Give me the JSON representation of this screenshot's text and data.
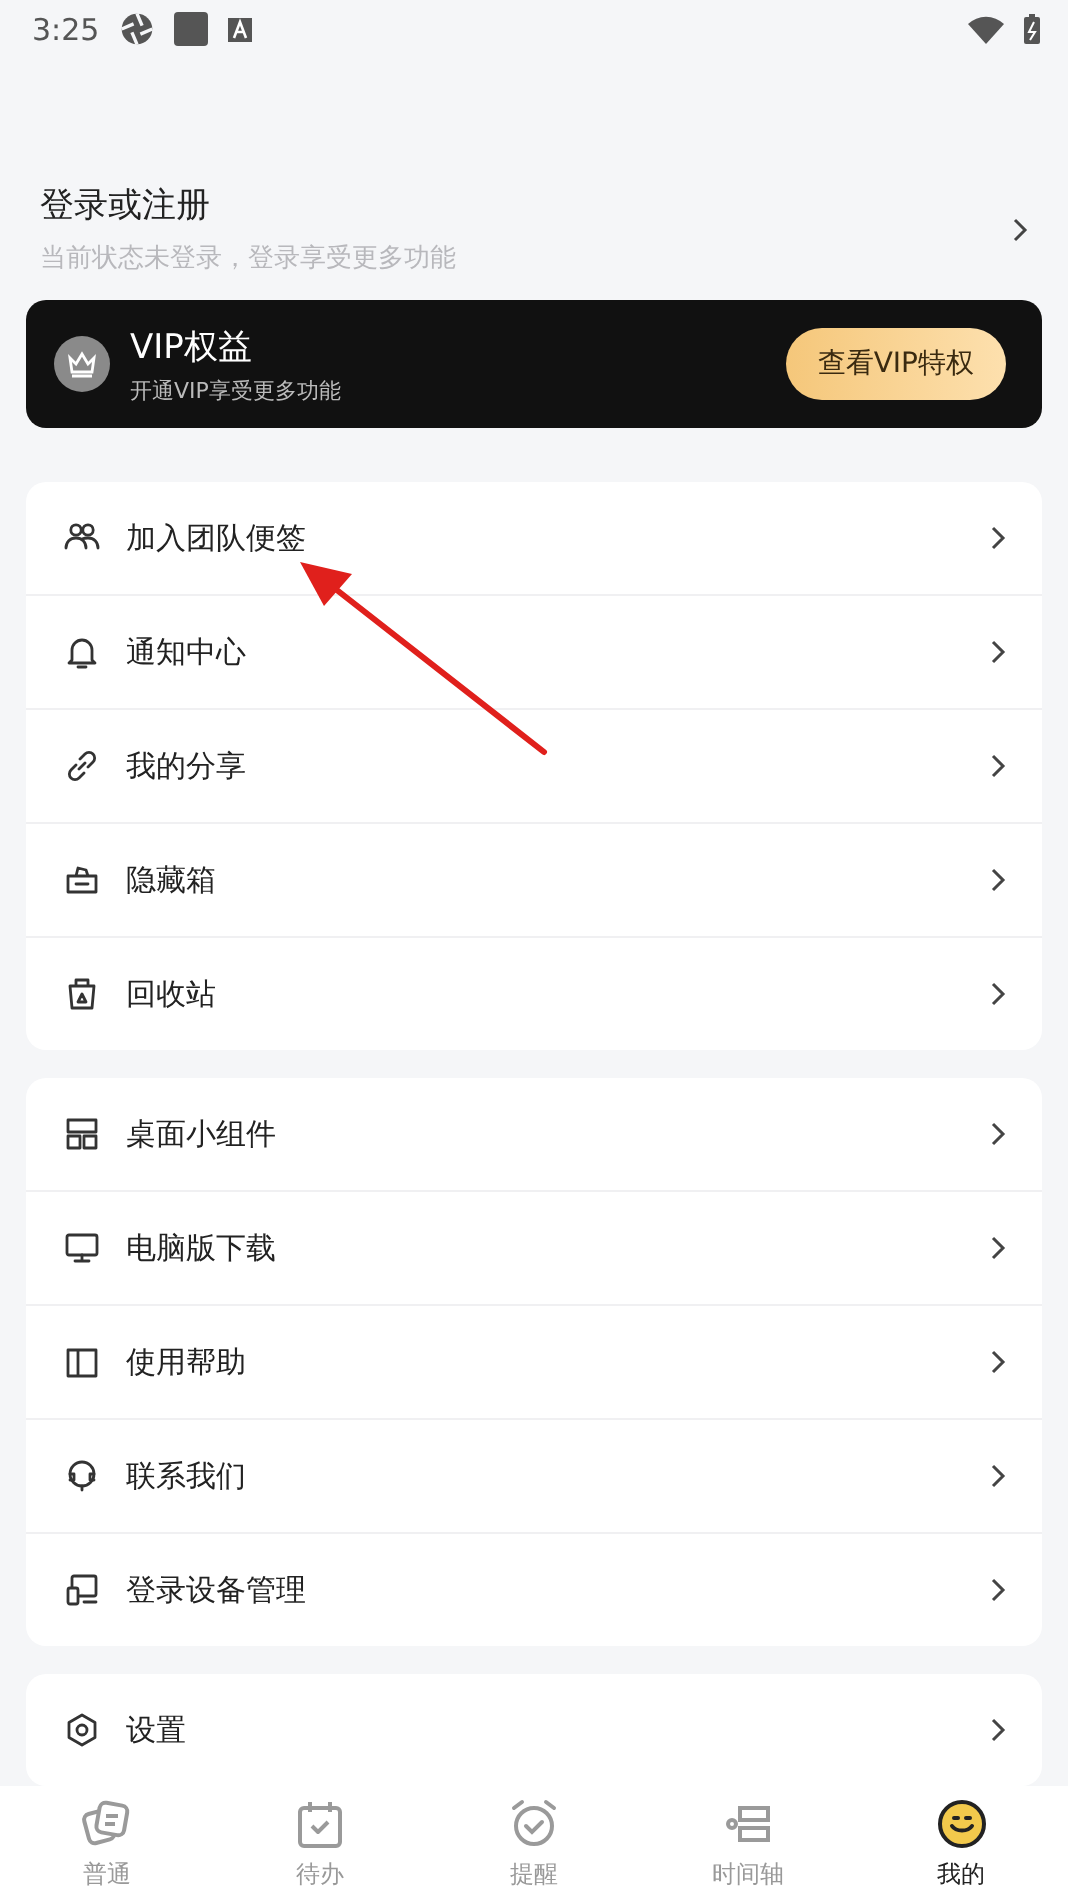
{
  "status_bar": {
    "time": "3:25"
  },
  "account": {
    "title": "登录或注册",
    "subtitle": "当前状态未登录，登录享受更多功能"
  },
  "vip_card": {
    "title": "VIP权益",
    "subtitle": "开通VIP享受更多功能",
    "button": "查看VIP特权"
  },
  "menu_groups": [
    {
      "items": [
        {
          "label": "加入团队便签"
        },
        {
          "label": "通知中心"
        },
        {
          "label": "我的分享"
        },
        {
          "label": "隐藏箱"
        },
        {
          "label": "回收站"
        }
      ]
    },
    {
      "items": [
        {
          "label": "桌面小组件"
        },
        {
          "label": "电脑版下载"
        },
        {
          "label": "使用帮助"
        },
        {
          "label": "联系我们"
        },
        {
          "label": "登录设备管理"
        }
      ]
    },
    {
      "items": [
        {
          "label": "设置"
        }
      ]
    }
  ],
  "bottom_nav": [
    {
      "label": "普通",
      "selected": false
    },
    {
      "label": "待办",
      "selected": false
    },
    {
      "label": "提醒",
      "selected": false
    },
    {
      "label": "时间轴",
      "selected": false
    },
    {
      "label": "我的",
      "selected": true
    }
  ]
}
